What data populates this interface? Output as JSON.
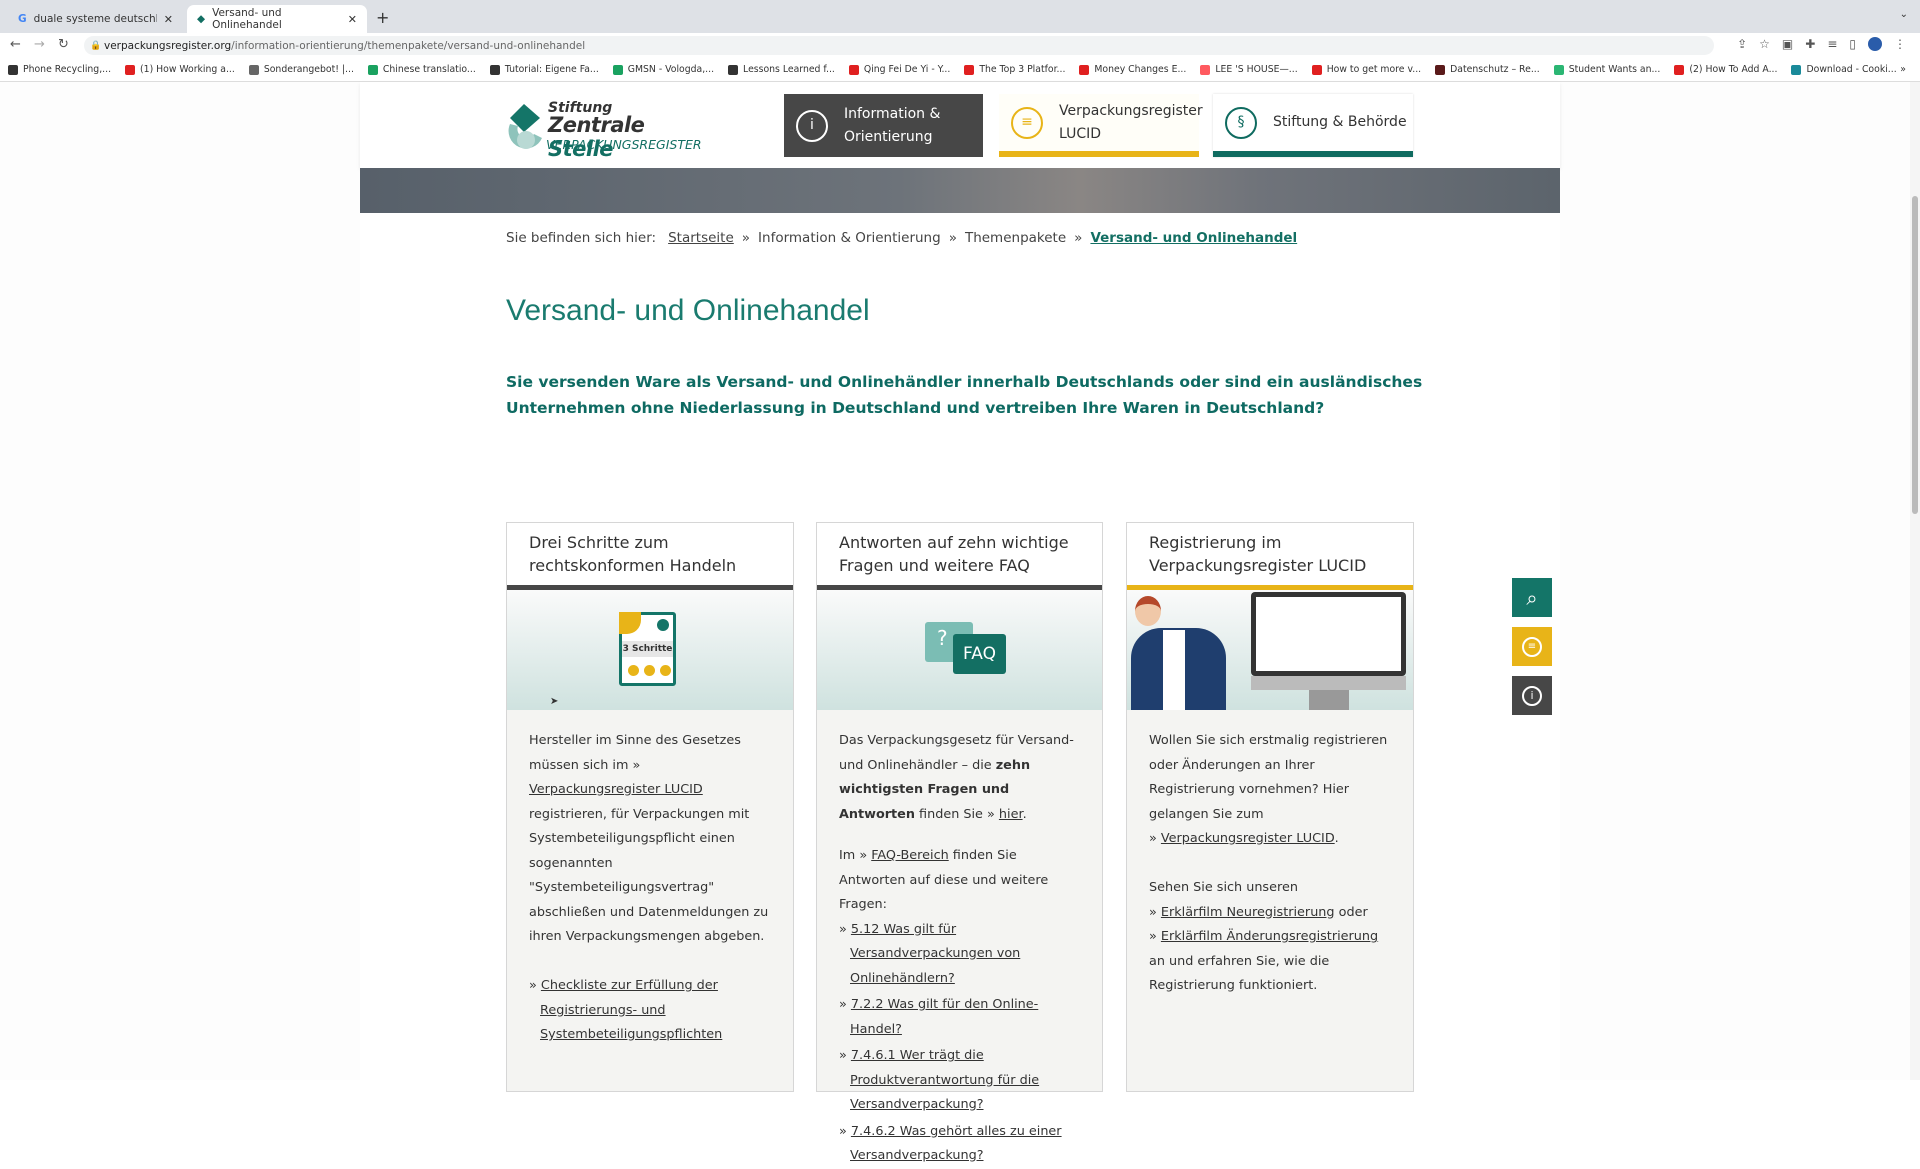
{
  "browser": {
    "tabs": [
      {
        "title": "duale systeme deutschland - G",
        "active": false
      },
      {
        "title": "Versand- und Onlinehandel",
        "active": true
      }
    ],
    "url_domain": "verpackungsregister.org",
    "url_path": "/information-orientierung/themenpakete/versand-und-onlinehandel",
    "bookmarks": [
      "Phone Recycling,...",
      "(1) How Working a...",
      "Sonderangebot! |...",
      "Chinese translatio...",
      "Tutorial: Eigene Fa...",
      "GMSN - Vologda,...",
      "Lessons Learned f...",
      "Qing Fei De Yi - Y...",
      "The Top 3 Platfor...",
      "Money Changes E...",
      "LEE 'S HOUSE—...",
      "How to get more v...",
      "Datenschutz – Re...",
      "Student Wants an...",
      "(2) How To Add A...",
      "Download - Cooki..."
    ]
  },
  "logo": {
    "line1": "Stiftung",
    "line2a": "Zentrale ",
    "line2b": "Stelle",
    "line3": "VERPACKUNGSREGISTER"
  },
  "nav": [
    {
      "label1": "Information &",
      "label2": "Orientierung",
      "icon": "info-chat-icon"
    },
    {
      "label1": "Verpackungsregister",
      "label2": "LUCID",
      "icon": "lucid-icon"
    },
    {
      "label1": "Stiftung & Behörde",
      "label2": "",
      "icon": "paragraph-icon"
    }
  ],
  "breadcrumb": {
    "prefix": "Sie befinden sich hier:",
    "items": [
      "Startseite",
      "Information & Orientierung",
      "Themenpakete",
      "Versand- und Onlinehandel"
    ],
    "separator": "»"
  },
  "title": "Versand- und Onlinehandel",
  "intro": "Sie versenden Ware als Versand- und Onlinehändler innerhalb Deutschlands oder sind ein ausländisches Unternehmen ohne Niederlassung in Deutschland und vertreiben Ihre Waren in Deutschland?",
  "cards": [
    {
      "title": "Drei Schritte zum rechtskonformen Handeln",
      "bar_color": "#474747",
      "image_label": "3 Schritte",
      "p1a": "Hersteller im Sinne des Gesetzes müssen sich im ",
      "p1link": "Verpackungsregister LUCID",
      "p1b": " registrieren, für Verpackungen mit Systembeteiligungspflicht einen sogenannten \"Systembeteiligungsvertrag\" abschließen und Datenmeldungen zu ihren Verpackungsmengen abgeben.",
      "link2": "Checkliste zur Erfüllung der Registrierungs- und Systembeteiligungspflichten"
    },
    {
      "title": "Antworten auf zehn wichtige Fragen und weitere FAQ",
      "bar_color": "#474747",
      "image_label": "FAQ",
      "image_q": "?",
      "p1a": "Das Verpackungsgesetz für Versand- und Onlinehändler – die ",
      "p1bold": "zehn wichtigsten Fragen und Antworten",
      "p1b": " finden Sie ",
      "p1link": "hier",
      "p2a": "Im ",
      "p2link": "FAQ-Bereich",
      "p2b": " finden Sie Antworten auf diese und weitere Fragen:",
      "links": [
        "5.12 Was gilt für Versandverpackungen von Onlinehändlern?",
        "7.2.2 Was gilt für den Online-Handel?",
        "7.4.6.1 Wer trägt die Produktverantwortung für die Versandverpackung?",
        "7.4.6.2 Was gehört alles zu einer Versandverpackung?"
      ]
    },
    {
      "title": "Registrierung im Verpackungsregister LUCID",
      "bar_color": "#e8b418",
      "p1a": "Wollen Sie sich erstmalig registrieren oder Änderungen an Ihrer Registrierung vornehmen? Hier gelangen Sie zum ",
      "p1link": "Verpackungsregister LUCID",
      "p2a": "Sehen Sie sich unseren ",
      "link_a": "Erklärfilm Neuregistrierung",
      "mid": " oder",
      "link_b": "Erklärfilm Änderungsregistrierung",
      "p2b": " an und erfahren Sie, wie die Registrierung funktioniert."
    }
  ],
  "colors": {
    "teal": "#0f6b60",
    "yellow": "#e8b418",
    "dark": "#474747"
  }
}
